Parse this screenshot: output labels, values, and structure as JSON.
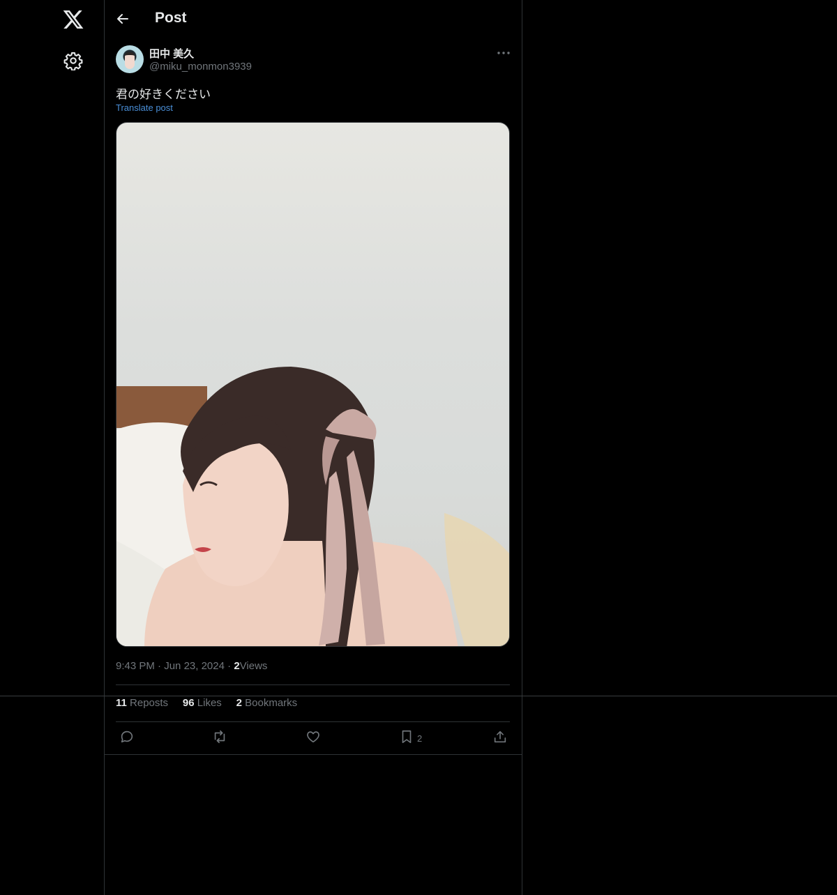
{
  "nav": {
    "logo_icon": "x-logo-icon",
    "settings_icon": "gear-icon"
  },
  "header": {
    "back_icon": "back-arrow-icon",
    "title": "Post"
  },
  "post": {
    "author": {
      "display_name": "田中 美久",
      "handle": "@miku_monmon3939"
    },
    "text": "君の好きください",
    "translate_label": "Translate post",
    "image_alt": "photo of a woman with a pink ribbon in her hair",
    "time": "9:43 PM",
    "separator": "·",
    "date": "Jun 23, 2024",
    "views_count": "2",
    "views_label": "Views",
    "stats": {
      "reposts_count": "11",
      "reposts_label": "Reposts",
      "likes_count": "96",
      "likes_label": "Likes",
      "bookmarks_count": "2",
      "bookmarks_label": "Bookmarks"
    },
    "actions": {
      "reply_icon": "reply-icon",
      "repost_icon": "repost-icon",
      "like_icon": "heart-icon",
      "bookmark_icon": "bookmark-icon",
      "bookmark_count": "2",
      "share_icon": "share-icon"
    }
  },
  "colors": {
    "background": "#000000",
    "text_primary": "#e7e9ea",
    "text_secondary": "#71767b",
    "link": "#4a8fd8",
    "border": "#2f3336"
  }
}
